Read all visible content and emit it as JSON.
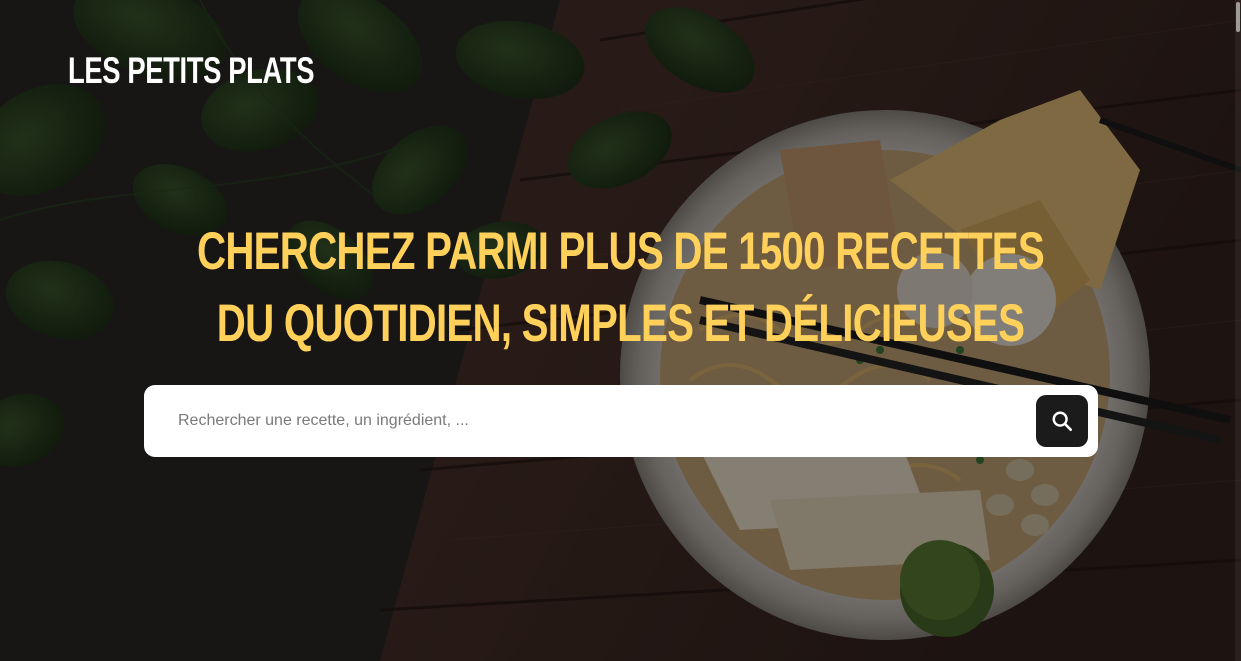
{
  "header": {
    "logo_text": "LES PETITS PLATS"
  },
  "hero": {
    "headline_line1": "CHERCHEZ PARMI PLUS DE 1500 RECETTES",
    "headline_line2": "DU QUOTIDIEN, SIMPLES ET DÉLICIEUSES",
    "background_image": "photo-food-bowl-noodles-chopsticks-on-wooden-table",
    "overlay_color": "#000000"
  },
  "search": {
    "placeholder": "Rechercher une recette, un ingrédient, ...",
    "value": "",
    "button_icon": "search-icon"
  },
  "colors": {
    "accent_yellow": "#FFD15B",
    "text_white": "#FFFFFF",
    "button_dark": "#1B1B1B",
    "search_bg": "#FFFFFF"
  }
}
